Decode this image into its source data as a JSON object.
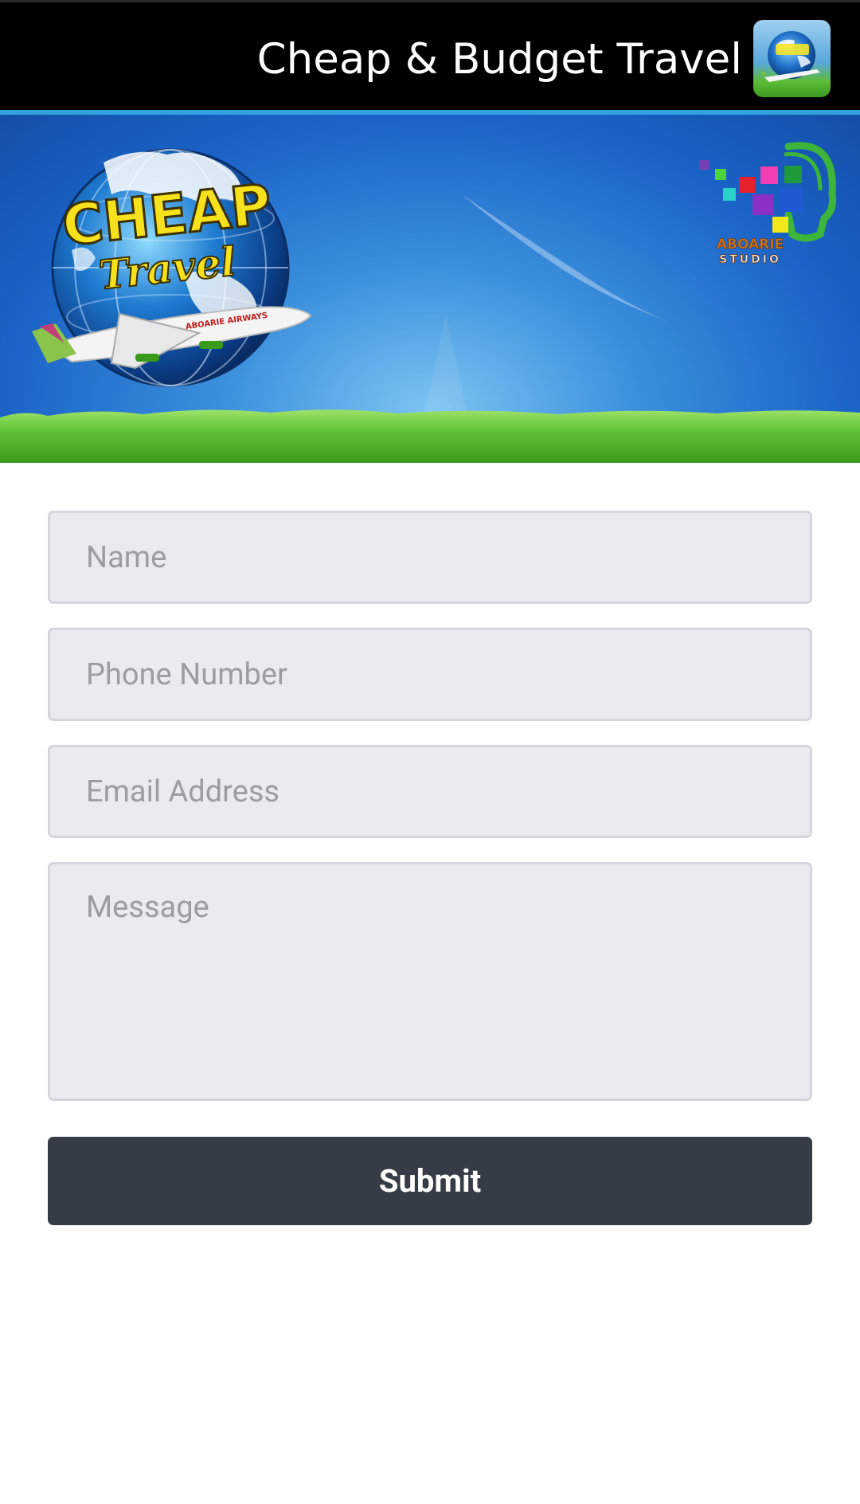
{
  "actionbar": {
    "title": "Cheap & Budget Travel",
    "icon": "cheap-travel-app-icon"
  },
  "banner": {
    "logo_text_main": "CHEAP",
    "logo_text_script": "Travel",
    "airline_text": "ABOARIE AIRWAYS",
    "studio_line1": "ABOARIE",
    "studio_line2": "STUDIO"
  },
  "form": {
    "name_placeholder": "Name",
    "phone_placeholder": "Phone Number",
    "email_placeholder": "Email Address",
    "message_placeholder": "Message",
    "submit_label": "Submit"
  },
  "colors": {
    "actionbar_bg": "#000000",
    "actionbar_divider": "#33a1e0",
    "field_bg": "#e9ebee",
    "button_bg": "#353c45"
  }
}
